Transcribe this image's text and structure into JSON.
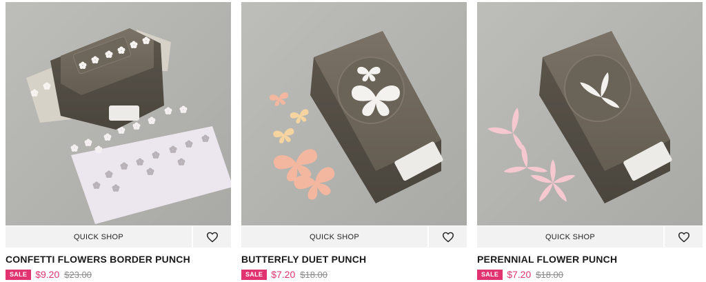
{
  "theme": {
    "sale_color": "#e0336f",
    "button_bg": "#f2f2f2"
  },
  "products": [
    {
      "name": "CONFETTI FLOWERS BORDER PUNCH",
      "quick_shop": "QUICK SHOP",
      "badge": "SALE",
      "sale_price": "$9.20",
      "original_price": "$23.00",
      "favorite_icon": "heart-outline-icon"
    },
    {
      "name": "BUTTERFLY DUET PUNCH",
      "quick_shop": "QUICK SHOP",
      "badge": "SALE",
      "sale_price": "$7.20",
      "original_price": "$18.00",
      "favorite_icon": "heart-outline-icon"
    },
    {
      "name": "PERENNIAL FLOWER PUNCH",
      "quick_shop": "QUICK SHOP",
      "badge": "SALE",
      "sale_price": "$7.20",
      "original_price": "$18.00",
      "favorite_icon": "heart-outline-icon"
    }
  ]
}
